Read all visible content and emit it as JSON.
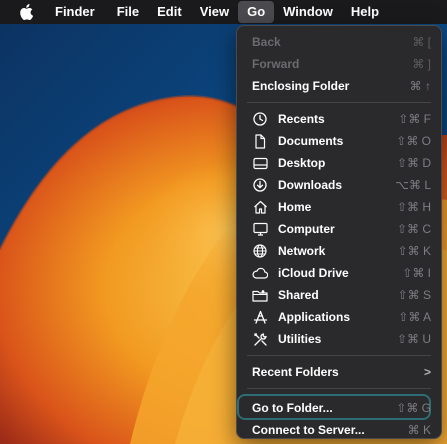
{
  "menubar": {
    "apple_icon": "apple-logo-icon",
    "app_name": "Finder",
    "items": [
      "File",
      "Edit",
      "View",
      "Go",
      "Window",
      "Help"
    ],
    "active_item": "Go"
  },
  "go_menu": {
    "back": {
      "label": "Back",
      "shortcut": "⌘ ["
    },
    "forward": {
      "label": "Forward",
      "shortcut": "⌘ ]"
    },
    "enclosing": {
      "label": "Enclosing Folder",
      "shortcut": "⌘ ↑"
    },
    "places": [
      {
        "label": "Recents",
        "shortcut": "⇧⌘ F",
        "icon": "clock-icon"
      },
      {
        "label": "Documents",
        "shortcut": "⇧⌘ O",
        "icon": "document-icon"
      },
      {
        "label": "Desktop",
        "shortcut": "⇧⌘ D",
        "icon": "desktop-icon"
      },
      {
        "label": "Downloads",
        "shortcut": "⌥⌘ L",
        "icon": "download-icon"
      },
      {
        "label": "Home",
        "shortcut": "⇧⌘ H",
        "icon": "home-icon"
      },
      {
        "label": "Computer",
        "shortcut": "⇧⌘ C",
        "icon": "computer-icon"
      },
      {
        "label": "Network",
        "shortcut": "⇧⌘ K",
        "icon": "network-icon"
      },
      {
        "label": "iCloud Drive",
        "shortcut": "⇧⌘ I",
        "icon": "cloud-icon"
      },
      {
        "label": "Shared",
        "shortcut": "⇧⌘ S",
        "icon": "shared-folder-icon"
      },
      {
        "label": "Applications",
        "shortcut": "⇧⌘ A",
        "icon": "applications-icon"
      },
      {
        "label": "Utilities",
        "shortcut": "⇧⌘ U",
        "icon": "utilities-icon"
      }
    ],
    "recent_folders": {
      "label": "Recent Folders",
      "submenu_indicator": ">"
    },
    "go_to_folder": {
      "label": "Go to Folder...",
      "shortcut": "⇧⌘ G"
    },
    "connect_server": {
      "label": "Connect to Server...",
      "shortcut": "⌘ K"
    }
  },
  "colors": {
    "menubar_bg": "#1a1a1c",
    "menu_bg": "#2a2a2c",
    "active_menu_bg": "#4b4b4f",
    "focus_ring": "#2c6e73",
    "wallpaper_blue": "#0f3a6b",
    "wallpaper_orange": "#f0941e"
  }
}
